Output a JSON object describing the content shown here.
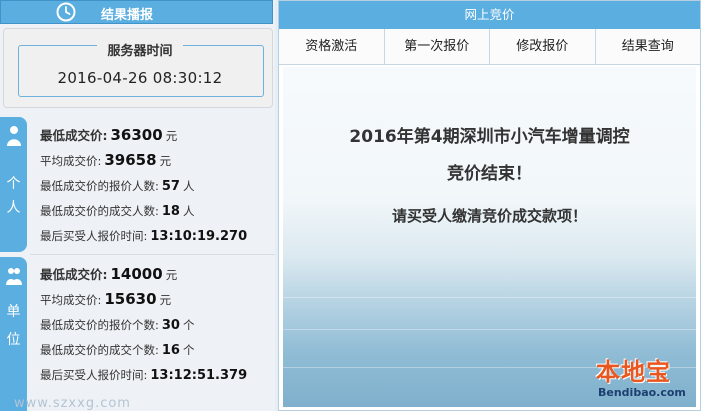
{
  "left_panel": {
    "header_title": "结果播报",
    "server_label": "服务器时间",
    "server_time": "2016-04-26 08:30:12",
    "personal": {
      "tag": [
        "个",
        "人"
      ],
      "lowest_price_label": "最低成交价:",
      "lowest_price": "36300",
      "lowest_price_unit": "元",
      "avg_price_label": "平均成交价:",
      "avg_price": "39658",
      "avg_price_unit": "元",
      "bid_count_label": "最低成交价的报价人数:",
      "bid_count": "57",
      "bid_count_unit": "人",
      "deal_count_label": "最低成交价的成交人数:",
      "deal_count": "18",
      "deal_count_unit": "人",
      "last_time_label": "最后买受人报价时间:",
      "last_time": "13:10:19.270"
    },
    "unit": {
      "tag": [
        "单",
        "位"
      ],
      "lowest_price_label": "最低成交价:",
      "lowest_price": "14000",
      "lowest_price_unit": "元",
      "avg_price_label": "平均成交价:",
      "avg_price": "15630",
      "avg_price_unit": "元",
      "bid_count_label": "最低成交价的报价个数:",
      "bid_count": "30",
      "bid_count_unit": "个",
      "deal_count_label": "最低成交价的成交个数:",
      "deal_count": "16",
      "deal_count_unit": "个",
      "last_time_label": "最后买受人报价时间:",
      "last_time": "13:12:51.379"
    },
    "watermark": "www.szxxg.com"
  },
  "right_panel": {
    "header_title": "网上竞价",
    "tabs": [
      "资格激活",
      "第一次报价",
      "修改报价",
      "结果查询"
    ],
    "message_line1": "2016年第4期深圳市小汽车增量调控",
    "message_line2": "竞价结束！",
    "message_line3": "请买受人缴清竞价成交款项！"
  },
  "logo": {
    "text": "本地宝",
    "sub": "Bendibao.com"
  },
  "colors": {
    "header_blue": "#5aaee0",
    "text_dark": "#333333",
    "logo_orange": "#e8571f"
  }
}
